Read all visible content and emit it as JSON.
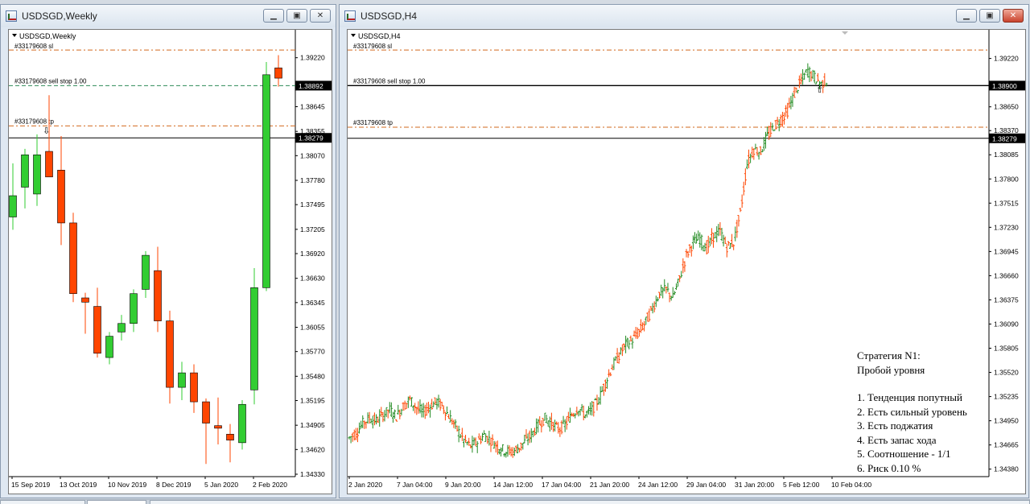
{
  "colors": {
    "bull": "#32cd32",
    "bear": "#ff4500",
    "level": "#d2691e",
    "dark": "#000000"
  },
  "left_window": {
    "title": "USDSGD,Weekly",
    "chart_label": "USDSGD,Weekly",
    "icon": "chart-window-icon",
    "buttons": {
      "minimize": "▁",
      "maximize": "▣",
      "close": "✕"
    },
    "order_labels": {
      "sl": "#33179608 sl",
      "sell_stop": "#33179608 sell stop 1.00",
      "tp": "#33179608 tp"
    },
    "price_tags": {
      "sell_stop": "1.38892",
      "last": "1.38279"
    },
    "y_ticks": [
      "1.39220",
      "1.38645",
      "1.38355",
      "1.38070",
      "1.37780",
      "1.37495",
      "1.37205",
      "1.36920",
      "1.36630",
      "1.36345",
      "1.36055",
      "1.35770",
      "1.35480",
      "1.35195",
      "1.34905",
      "1.34620",
      "1.34330"
    ],
    "x_ticks": [
      "15 Sep 2019",
      "13 Oct 2019",
      "10 Nov 2019",
      "8 Dec 2019",
      "5 Jan 2020",
      "2 Feb 2020"
    ]
  },
  "right_window": {
    "title": "USDSGD,H4",
    "chart_label": "USDSGD,H4",
    "icon": "chart-window-icon",
    "buttons": {
      "minimize": "▁",
      "maximize": "▣",
      "close": "✕"
    },
    "order_labels": {
      "sl": "#33179608 sl",
      "sell_stop": "#33179608 sell stop 1.00",
      "tp": "#33179608 tp"
    },
    "price_tags": {
      "sell_stop": "1.38900",
      "last": "1.38279"
    },
    "y_ticks": [
      "1.39220",
      "1.38650",
      "1.38370",
      "1.38085",
      "1.37800",
      "1.37515",
      "1.37230",
      "1.36945",
      "1.36660",
      "1.36375",
      "1.36090",
      "1.35805",
      "1.35520",
      "1.35235",
      "1.34950",
      "1.34665",
      "1.34380"
    ],
    "x_ticks": [
      "2 Jan 2020",
      "7 Jan 04:00",
      "9 Jan 20:00",
      "14 Jan 12:00",
      "17 Jan 04:00",
      "21 Jan 20:00",
      "24 Jan 12:00",
      "29 Jan 04:00",
      "31 Jan 20:00",
      "5 Feb 12:00",
      "10 Feb 04:00"
    ]
  },
  "strategy": {
    "title_line1": "Стратегия N1:",
    "title_line2": "Пробой уровня",
    "items": [
      "1. Тенденция попутный",
      "2. Есть сильный уровень",
      "3. Есть поджатия",
      "4. Есть запас хода",
      "5. Соотношение - 1/1",
      "6. Риск 0.10 %"
    ]
  },
  "chart_data": [
    {
      "type": "candlestick",
      "title": "USDSGD,Weekly",
      "categories": [
        "15 Sep 2019",
        "13 Oct 2019",
        "10 Nov 2019",
        "8 Dec 2019",
        "5 Jan 2020",
        "2 Feb 2020"
      ],
      "ylim": [
        1.3433,
        1.3951
      ],
      "levels": {
        "sl": 1.3931,
        "sell_stop": 1.38892,
        "tp": 1.3842,
        "last": 1.38279
      },
      "candles": [
        {
          "o": 1.3735,
          "h": 1.3798,
          "l": 1.372,
          "c": 1.376
        },
        {
          "o": 1.377,
          "h": 1.3815,
          "l": 1.3745,
          "c": 1.3808
        },
        {
          "o": 1.3762,
          "h": 1.3832,
          "l": 1.3748,
          "c": 1.3808
        },
        {
          "o": 1.3812,
          "h": 1.3878,
          "l": 1.3795,
          "c": 1.3782
        },
        {
          "o": 1.379,
          "h": 1.383,
          "l": 1.3702,
          "c": 1.3728
        },
        {
          "o": 1.3728,
          "h": 1.374,
          "l": 1.3635,
          "c": 1.3645
        },
        {
          "o": 1.364,
          "h": 1.3646,
          "l": 1.3598,
          "c": 1.3635
        },
        {
          "o": 1.363,
          "h": 1.3652,
          "l": 1.357,
          "c": 1.3575
        },
        {
          "o": 1.357,
          "h": 1.36,
          "l": 1.3562,
          "c": 1.3595
        },
        {
          "o": 1.36,
          "h": 1.362,
          "l": 1.359,
          "c": 1.361
        },
        {
          "o": 1.361,
          "h": 1.365,
          "l": 1.36,
          "c": 1.3645
        },
        {
          "o": 1.365,
          "h": 1.3695,
          "l": 1.364,
          "c": 1.369
        },
        {
          "o": 1.3672,
          "h": 1.37,
          "l": 1.36,
          "c": 1.3613
        },
        {
          "o": 1.3613,
          "h": 1.3625,
          "l": 1.3516,
          "c": 1.3535
        },
        {
          "o": 1.3535,
          "h": 1.3565,
          "l": 1.352,
          "c": 1.3552
        },
        {
          "o": 1.3552,
          "h": 1.3562,
          "l": 1.3505,
          "c": 1.3518
        },
        {
          "o": 1.3518,
          "h": 1.3522,
          "l": 1.3445,
          "c": 1.3493
        },
        {
          "o": 1.349,
          "h": 1.3523,
          "l": 1.3468,
          "c": 1.3487
        },
        {
          "o": 1.348,
          "h": 1.3492,
          "l": 1.3447,
          "c": 1.3473
        },
        {
          "o": 1.347,
          "h": 1.352,
          "l": 1.3462,
          "c": 1.3515
        },
        {
          "o": 1.3532,
          "h": 1.3675,
          "l": 1.3515,
          "c": 1.3652
        },
        {
          "o": 1.3652,
          "h": 1.3917,
          "l": 1.3648,
          "c": 1.3902
        },
        {
          "o": 1.391,
          "h": 1.3925,
          "l": 1.3888,
          "c": 1.3898
        }
      ]
    },
    {
      "type": "candlestick",
      "title": "USDSGD,H4",
      "categories": [
        "2 Jan 2020",
        "7 Jan 04:00",
        "9 Jan 20:00",
        "14 Jan 12:00",
        "17 Jan 04:00",
        "21 Jan 20:00",
        "24 Jan 12:00",
        "29 Jan 04:00",
        "31 Jan 20:00",
        "5 Feb 12:00",
        "10 Feb 04:00"
      ],
      "ylim": [
        1.3432,
        1.3952
      ],
      "levels": {
        "sl": 1.3932,
        "sell_stop": 1.389,
        "tp": 1.3841,
        "last": 1.38279
      },
      "close_path": [
        1.3475,
        1.348,
        1.3492,
        1.3498,
        1.3495,
        1.3502,
        1.3508,
        1.35,
        1.3512,
        1.352,
        1.351,
        1.3505,
        1.3512,
        1.3518,
        1.351,
        1.3498,
        1.3485,
        1.3472,
        1.3465,
        1.347,
        1.3478,
        1.3472,
        1.3465,
        1.346,
        1.3458,
        1.3462,
        1.347,
        1.3478,
        1.349,
        1.3498,
        1.3492,
        1.3485,
        1.349,
        1.3502,
        1.351,
        1.3502,
        1.3508,
        1.352,
        1.354,
        1.3558,
        1.3572,
        1.3585,
        1.359,
        1.36,
        1.3612,
        1.3628,
        1.3645,
        1.365,
        1.364,
        1.3662,
        1.369,
        1.3705,
        1.371,
        1.3698,
        1.3712,
        1.3718,
        1.37,
        1.3705,
        1.374,
        1.3798,
        1.3815,
        1.3812,
        1.383,
        1.3842,
        1.385,
        1.386,
        1.388,
        1.3895,
        1.3908,
        1.39,
        1.3892,
        1.3897
      ]
    }
  ]
}
